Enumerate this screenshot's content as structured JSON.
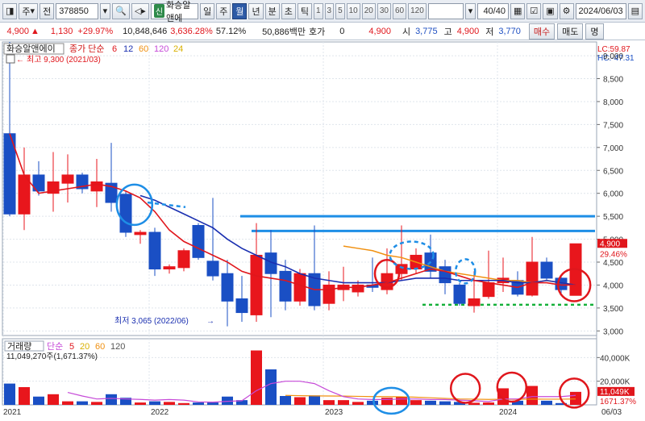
{
  "toolbar": {
    "period_label": "주",
    "jeon_label": "전",
    "stock_code": "378850",
    "sin_label": "신",
    "stock_name": "화승알앤에",
    "tabs": [
      "일",
      "주",
      "월",
      "년",
      "분",
      "초",
      "틱"
    ],
    "active_tab": "월",
    "intervals": [
      "1",
      "3",
      "5",
      "10",
      "20",
      "30",
      "60",
      "120"
    ],
    "count": "40/40",
    "date": "2024/06/03"
  },
  "infobar": {
    "price": "4,900",
    "change": "1,130",
    "change_pct": "+29.97%",
    "volume": "10,848,646",
    "vol_ratio": "3,636.28%",
    "turnover": "57.12%",
    "amount": "50,886백만",
    "quote_label": "호가",
    "quote_value": "0",
    "quote_price": "4,900",
    "open_label": "시",
    "open": "3,775",
    "high_label": "고",
    "high": "4,900",
    "low_label": "저",
    "low": "3,770",
    "buy_label": "매수",
    "sell_label": "매도",
    "alt_label": "명"
  },
  "colors": {
    "up": "#e8161c",
    "down": "#1a4fc4",
    "ma5": "#e0161c",
    "ma12": "#1a2fb0",
    "ma60": "#f09010",
    "ma120": "#c64ad8",
    "ma24": "#d9b000",
    "annot_blue": "#1e8ee6",
    "annot_green": "#14b03a",
    "annot_red": "#e0161c"
  },
  "chart_data": [
    {
      "type": "candlestick",
      "title": "화승알앤에이",
      "legend": {
        "label": "종가 단순",
        "periods": [
          "6",
          "12",
          "60",
          "120",
          "24"
        ]
      },
      "x_labels": [
        "2021",
        "2022",
        "2023",
        "2024",
        "06/03"
      ],
      "ylim": [
        2900,
        9300
      ],
      "y_ticks": [
        "9,000",
        "8,500",
        "8,000",
        "7,500",
        "7,000",
        "6,500",
        "6,000",
        "5,500",
        "5,000",
        "4,500",
        "4,000",
        "3,500",
        "3,000"
      ],
      "y_tick_values": [
        9000,
        8500,
        8000,
        7500,
        7000,
        6500,
        6000,
        5500,
        5000,
        4500,
        4000,
        3500,
        3000
      ],
      "max_annotation": "최고 9,300 (2021/03)",
      "min_annotation": "최저 3,065 (2022/06)",
      "lc_label": "LC:59.87",
      "hc_label": "HC:-47.31",
      "last_price_label": "4,900",
      "last_pct_label": "29.46%",
      "candles": [
        {
          "o": 7300,
          "h": 9300,
          "l": 5500,
          "c": 5550
        },
        {
          "o": 5550,
          "h": 7000,
          "l": 5200,
          "c": 6400
        },
        {
          "o": 6400,
          "h": 6700,
          "l": 5950,
          "c": 6050
        },
        {
          "o": 6000,
          "h": 6900,
          "l": 5600,
          "c": 6250
        },
        {
          "o": 6220,
          "h": 6850,
          "l": 5800,
          "c": 6400
        },
        {
          "o": 6400,
          "h": 6450,
          "l": 6000,
          "c": 6100
        },
        {
          "o": 6050,
          "h": 6750,
          "l": 5700,
          "c": 6250
        },
        {
          "o": 6220,
          "h": 7100,
          "l": 5600,
          "c": 5800
        },
        {
          "o": 5980,
          "h": 6050,
          "l": 5050,
          "c": 5150
        },
        {
          "o": 5100,
          "h": 5200,
          "l": 4900,
          "c": 5150
        },
        {
          "o": 5150,
          "h": 5250,
          "l": 4200,
          "c": 4350
        },
        {
          "o": 4350,
          "h": 4450,
          "l": 4250,
          "c": 4400
        },
        {
          "o": 4380,
          "h": 4800,
          "l": 4300,
          "c": 4750
        },
        {
          "o": 5300,
          "h": 5350,
          "l": 4550,
          "c": 4600
        },
        {
          "o": 4520,
          "h": 5900,
          "l": 4100,
          "c": 4200
        },
        {
          "o": 4250,
          "h": 4550,
          "l": 3100,
          "c": 3650
        },
        {
          "o": 3700,
          "h": 4200,
          "l": 3200,
          "c": 3400
        },
        {
          "o": 3350,
          "h": 5350,
          "l": 3200,
          "c": 4650
        },
        {
          "o": 4700,
          "h": 5200,
          "l": 3300,
          "c": 4250
        },
        {
          "o": 4300,
          "h": 4550,
          "l": 3450,
          "c": 3650
        },
        {
          "o": 3650,
          "h": 4350,
          "l": 3550,
          "c": 4250
        },
        {
          "o": 4250,
          "h": 5300,
          "l": 3450,
          "c": 3550
        },
        {
          "o": 3600,
          "h": 4300,
          "l": 3450,
          "c": 4000
        },
        {
          "o": 3900,
          "h": 4400,
          "l": 3650,
          "c": 4000
        },
        {
          "o": 3850,
          "h": 4100,
          "l": 3750,
          "c": 4000
        },
        {
          "o": 4000,
          "h": 4600,
          "l": 3850,
          "c": 3950
        },
        {
          "o": 3900,
          "h": 4800,
          "l": 3800,
          "c": 4250
        },
        {
          "o": 4250,
          "h": 5300,
          "l": 4100,
          "c": 4450
        },
        {
          "o": 4350,
          "h": 4800,
          "l": 4250,
          "c": 4650
        },
        {
          "o": 4700,
          "h": 5100,
          "l": 4150,
          "c": 4300
        },
        {
          "o": 4400,
          "h": 4550,
          "l": 3800,
          "c": 4050
        },
        {
          "o": 4000,
          "h": 4050,
          "l": 3550,
          "c": 3600
        },
        {
          "o": 3550,
          "h": 4300,
          "l": 3400,
          "c": 3700
        },
        {
          "o": 3750,
          "h": 4750,
          "l": 3700,
          "c": 4050
        },
        {
          "o": 4050,
          "h": 4600,
          "l": 3850,
          "c": 4150
        },
        {
          "o": 4100,
          "h": 4300,
          "l": 3750,
          "c": 3800
        },
        {
          "o": 3780,
          "h": 5050,
          "l": 3750,
          "c": 4500
        },
        {
          "o": 4500,
          "h": 4600,
          "l": 4100,
          "c": 4150
        },
        {
          "o": 4150,
          "h": 4200,
          "l": 3800,
          "c": 3900
        },
        {
          "o": 3775,
          "h": 4900,
          "l": 3770,
          "c": 4900
        }
      ],
      "ma6": [
        7300,
        6400,
        6000,
        6050,
        6100,
        6150,
        6200,
        6150,
        6050,
        5900,
        5600,
        5200,
        4950,
        4800,
        4650,
        4500,
        4300,
        4200,
        4150,
        4100,
        4000,
        3900,
        3900,
        3950,
        3950,
        4000,
        4050,
        4150,
        4250,
        4350,
        4300,
        4200,
        4100,
        4050,
        4000,
        3950,
        4050,
        4050,
        4000,
        4000
      ],
      "ma12": [
        null,
        null,
        null,
        null,
        null,
        null,
        null,
        null,
        null,
        5950,
        5850,
        5700,
        5550,
        5400,
        5250,
        5000,
        4800,
        4650,
        4500,
        4400,
        4250,
        4150,
        4100,
        4050,
        4050,
        4050,
        4050,
        4100,
        4150,
        4150,
        4150,
        4100,
        4100,
        4100,
        4100,
        4050,
        4050,
        4100,
        4050,
        4000
      ],
      "ma24": [
        null,
        null,
        null,
        null,
        null,
        null,
        null,
        null,
        null,
        null,
        null,
        null,
        null,
        null,
        null,
        null,
        null,
        null,
        null,
        null,
        null,
        null,
        null,
        4850,
        4800,
        4750,
        4650,
        4600,
        4500,
        4400,
        4300,
        4250,
        4200,
        4150,
        4100,
        4100,
        4050,
        4100,
        4050,
        4000
      ],
      "hlines": [
        5500,
        5180
      ],
      "support_line": 3570
    },
    {
      "type": "bar",
      "title": "거래량",
      "legend": {
        "label": "단순",
        "periods": [
          "5",
          "20",
          "60",
          "120"
        ]
      },
      "volume_label": "11,049,270주(1,671.37%)",
      "ylim": [
        0,
        45000
      ],
      "y_ticks": [
        "40,000K",
        "20,000K"
      ],
      "y_tick_values": [
        40000,
        20000
      ],
      "last_volume_label": "11,049K",
      "last_vol_pct_label": "1671.37%",
      "values": [
        18000,
        15000,
        7000,
        9000,
        3000,
        3000,
        2500,
        9000,
        6000,
        2000,
        3000,
        2500,
        1500,
        2000,
        2000,
        7000,
        4000,
        46000,
        30000,
        7500,
        6500,
        8000,
        4000,
        4000,
        2500,
        3500,
        6000,
        6500,
        4000,
        3500,
        3000,
        2500,
        1800,
        2000,
        14000,
        3500,
        16000,
        3500,
        1500,
        11000
      ],
      "ma5": [
        null,
        null,
        null,
        null,
        10500,
        7500,
        5000,
        5500,
        5000,
        4600,
        4000,
        4500,
        4000,
        2500,
        2300,
        3000,
        3500,
        12000,
        18000,
        20000,
        20000,
        18000,
        12000,
        7000,
        5000,
        4500,
        4500,
        5000,
        5000,
        4500,
        4500,
        4000,
        3500,
        2800,
        5000,
        5000,
        7000,
        7000,
        7000,
        8000
      ],
      "ma20": [
        null,
        null,
        null,
        null,
        null,
        null,
        null,
        null,
        null,
        null,
        null,
        null,
        null,
        null,
        null,
        null,
        null,
        null,
        null,
        8000,
        7800,
        7600,
        7500,
        7400,
        7200,
        7000,
        7000,
        6800,
        6500,
        6000,
        5500,
        5000,
        4800,
        4600,
        4800,
        4700,
        4900,
        4800,
        4800,
        5000
      ]
    }
  ]
}
